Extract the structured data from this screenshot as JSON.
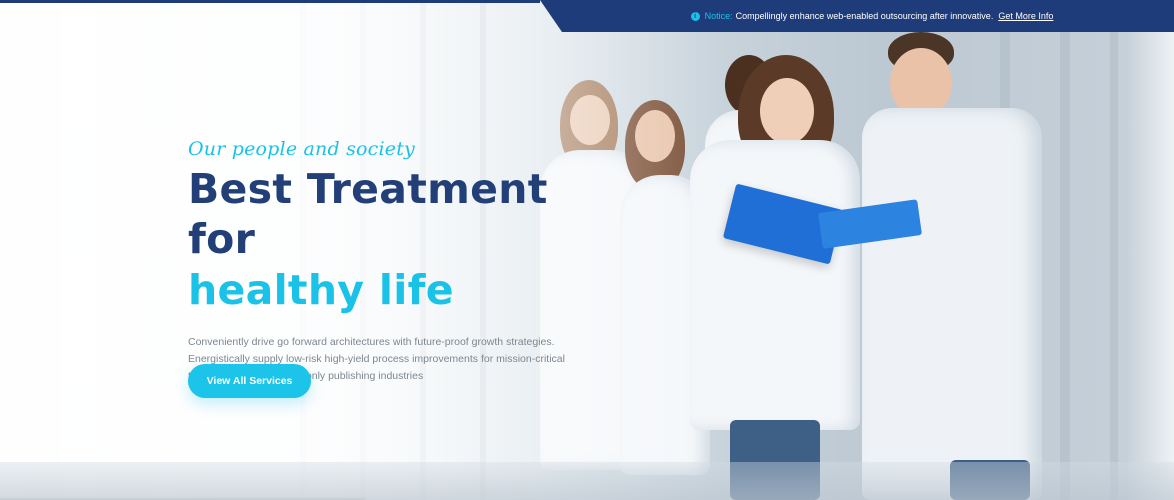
{
  "notice": {
    "icon": "info-icon",
    "label": "Notice:",
    "text": "Compellingly enhance web-enabled outsourcing after innovative.",
    "link": "Get More Info"
  },
  "hero": {
    "tagline": "Our people and society",
    "title_line1": "Best Treatment for",
    "title_line2": "healthy life",
    "description": "Conveniently drive go forward architectures with future-proof growth strategies. Energistically supply low-risk high-yield process improvements for mission-critical testing procedures commonly publishing industries",
    "cta_label": "View All Services"
  },
  "colors": {
    "navy": "#233f78",
    "accent": "#19c2e6",
    "notice_bg": "#1f3c7a"
  }
}
